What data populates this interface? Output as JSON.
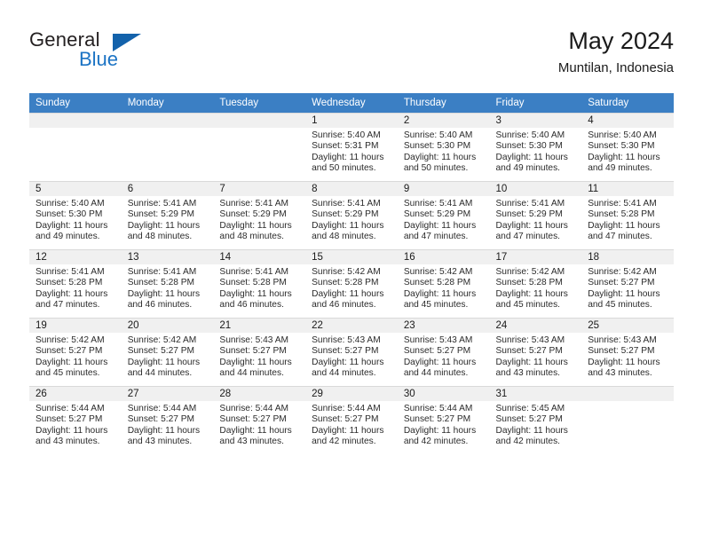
{
  "brand": {
    "general": "General",
    "blue": "Blue",
    "triangle_color": "#1362ab"
  },
  "header": {
    "title": "May 2024",
    "location": "Muntilan, Indonesia",
    "header_bg": "#3b7fc4"
  },
  "weekday_headers": [
    "Sunday",
    "Monday",
    "Tuesday",
    "Wednesday",
    "Thursday",
    "Friday",
    "Saturday"
  ],
  "labels": {
    "sunrise_prefix": "Sunrise:",
    "sunset_prefix": "Sunset:",
    "daylight_prefix": "Daylight:"
  },
  "weeks": [
    [
      {
        "day": "",
        "empty": true
      },
      {
        "day": "",
        "empty": true
      },
      {
        "day": "",
        "empty": true
      },
      {
        "day": "1",
        "sunrise": "Sunrise: 5:40 AM",
        "sunset": "Sunset: 5:31 PM",
        "daylight_line1": "Daylight: 11 hours",
        "daylight_line2": "and 50 minutes."
      },
      {
        "day": "2",
        "sunrise": "Sunrise: 5:40 AM",
        "sunset": "Sunset: 5:30 PM",
        "daylight_line1": "Daylight: 11 hours",
        "daylight_line2": "and 50 minutes."
      },
      {
        "day": "3",
        "sunrise": "Sunrise: 5:40 AM",
        "sunset": "Sunset: 5:30 PM",
        "daylight_line1": "Daylight: 11 hours",
        "daylight_line2": "and 49 minutes."
      },
      {
        "day": "4",
        "sunrise": "Sunrise: 5:40 AM",
        "sunset": "Sunset: 5:30 PM",
        "daylight_line1": "Daylight: 11 hours",
        "daylight_line2": "and 49 minutes."
      }
    ],
    [
      {
        "day": "5",
        "sunrise": "Sunrise: 5:40 AM",
        "sunset": "Sunset: 5:30 PM",
        "daylight_line1": "Daylight: 11 hours",
        "daylight_line2": "and 49 minutes."
      },
      {
        "day": "6",
        "sunrise": "Sunrise: 5:41 AM",
        "sunset": "Sunset: 5:29 PM",
        "daylight_line1": "Daylight: 11 hours",
        "daylight_line2": "and 48 minutes."
      },
      {
        "day": "7",
        "sunrise": "Sunrise: 5:41 AM",
        "sunset": "Sunset: 5:29 PM",
        "daylight_line1": "Daylight: 11 hours",
        "daylight_line2": "and 48 minutes."
      },
      {
        "day": "8",
        "sunrise": "Sunrise: 5:41 AM",
        "sunset": "Sunset: 5:29 PM",
        "daylight_line1": "Daylight: 11 hours",
        "daylight_line2": "and 48 minutes."
      },
      {
        "day": "9",
        "sunrise": "Sunrise: 5:41 AM",
        "sunset": "Sunset: 5:29 PM",
        "daylight_line1": "Daylight: 11 hours",
        "daylight_line2": "and 47 minutes."
      },
      {
        "day": "10",
        "sunrise": "Sunrise: 5:41 AM",
        "sunset": "Sunset: 5:29 PM",
        "daylight_line1": "Daylight: 11 hours",
        "daylight_line2": "and 47 minutes."
      },
      {
        "day": "11",
        "sunrise": "Sunrise: 5:41 AM",
        "sunset": "Sunset: 5:28 PM",
        "daylight_line1": "Daylight: 11 hours",
        "daylight_line2": "and 47 minutes."
      }
    ],
    [
      {
        "day": "12",
        "sunrise": "Sunrise: 5:41 AM",
        "sunset": "Sunset: 5:28 PM",
        "daylight_line1": "Daylight: 11 hours",
        "daylight_line2": "and 47 minutes."
      },
      {
        "day": "13",
        "sunrise": "Sunrise: 5:41 AM",
        "sunset": "Sunset: 5:28 PM",
        "daylight_line1": "Daylight: 11 hours",
        "daylight_line2": "and 46 minutes."
      },
      {
        "day": "14",
        "sunrise": "Sunrise: 5:41 AM",
        "sunset": "Sunset: 5:28 PM",
        "daylight_line1": "Daylight: 11 hours",
        "daylight_line2": "and 46 minutes."
      },
      {
        "day": "15",
        "sunrise": "Sunrise: 5:42 AM",
        "sunset": "Sunset: 5:28 PM",
        "daylight_line1": "Daylight: 11 hours",
        "daylight_line2": "and 46 minutes."
      },
      {
        "day": "16",
        "sunrise": "Sunrise: 5:42 AM",
        "sunset": "Sunset: 5:28 PM",
        "daylight_line1": "Daylight: 11 hours",
        "daylight_line2": "and 45 minutes."
      },
      {
        "day": "17",
        "sunrise": "Sunrise: 5:42 AM",
        "sunset": "Sunset: 5:28 PM",
        "daylight_line1": "Daylight: 11 hours",
        "daylight_line2": "and 45 minutes."
      },
      {
        "day": "18",
        "sunrise": "Sunrise: 5:42 AM",
        "sunset": "Sunset: 5:27 PM",
        "daylight_line1": "Daylight: 11 hours",
        "daylight_line2": "and 45 minutes."
      }
    ],
    [
      {
        "day": "19",
        "sunrise": "Sunrise: 5:42 AM",
        "sunset": "Sunset: 5:27 PM",
        "daylight_line1": "Daylight: 11 hours",
        "daylight_line2": "and 45 minutes."
      },
      {
        "day": "20",
        "sunrise": "Sunrise: 5:42 AM",
        "sunset": "Sunset: 5:27 PM",
        "daylight_line1": "Daylight: 11 hours",
        "daylight_line2": "and 44 minutes."
      },
      {
        "day": "21",
        "sunrise": "Sunrise: 5:43 AM",
        "sunset": "Sunset: 5:27 PM",
        "daylight_line1": "Daylight: 11 hours",
        "daylight_line2": "and 44 minutes."
      },
      {
        "day": "22",
        "sunrise": "Sunrise: 5:43 AM",
        "sunset": "Sunset: 5:27 PM",
        "daylight_line1": "Daylight: 11 hours",
        "daylight_line2": "and 44 minutes."
      },
      {
        "day": "23",
        "sunrise": "Sunrise: 5:43 AM",
        "sunset": "Sunset: 5:27 PM",
        "daylight_line1": "Daylight: 11 hours",
        "daylight_line2": "and 44 minutes."
      },
      {
        "day": "24",
        "sunrise": "Sunrise: 5:43 AM",
        "sunset": "Sunset: 5:27 PM",
        "daylight_line1": "Daylight: 11 hours",
        "daylight_line2": "and 43 minutes."
      },
      {
        "day": "25",
        "sunrise": "Sunrise: 5:43 AM",
        "sunset": "Sunset: 5:27 PM",
        "daylight_line1": "Daylight: 11 hours",
        "daylight_line2": "and 43 minutes."
      }
    ],
    [
      {
        "day": "26",
        "sunrise": "Sunrise: 5:44 AM",
        "sunset": "Sunset: 5:27 PM",
        "daylight_line1": "Daylight: 11 hours",
        "daylight_line2": "and 43 minutes."
      },
      {
        "day": "27",
        "sunrise": "Sunrise: 5:44 AM",
        "sunset": "Sunset: 5:27 PM",
        "daylight_line1": "Daylight: 11 hours",
        "daylight_line2": "and 43 minutes."
      },
      {
        "day": "28",
        "sunrise": "Sunrise: 5:44 AM",
        "sunset": "Sunset: 5:27 PM",
        "daylight_line1": "Daylight: 11 hours",
        "daylight_line2": "and 43 minutes."
      },
      {
        "day": "29",
        "sunrise": "Sunrise: 5:44 AM",
        "sunset": "Sunset: 5:27 PM",
        "daylight_line1": "Daylight: 11 hours",
        "daylight_line2": "and 42 minutes."
      },
      {
        "day": "30",
        "sunrise": "Sunrise: 5:44 AM",
        "sunset": "Sunset: 5:27 PM",
        "daylight_line1": "Daylight: 11 hours",
        "daylight_line2": "and 42 minutes."
      },
      {
        "day": "31",
        "sunrise": "Sunrise: 5:45 AM",
        "sunset": "Sunset: 5:27 PM",
        "daylight_line1": "Daylight: 11 hours",
        "daylight_line2": "and 42 minutes."
      },
      {
        "day": "",
        "empty": true
      }
    ]
  ]
}
